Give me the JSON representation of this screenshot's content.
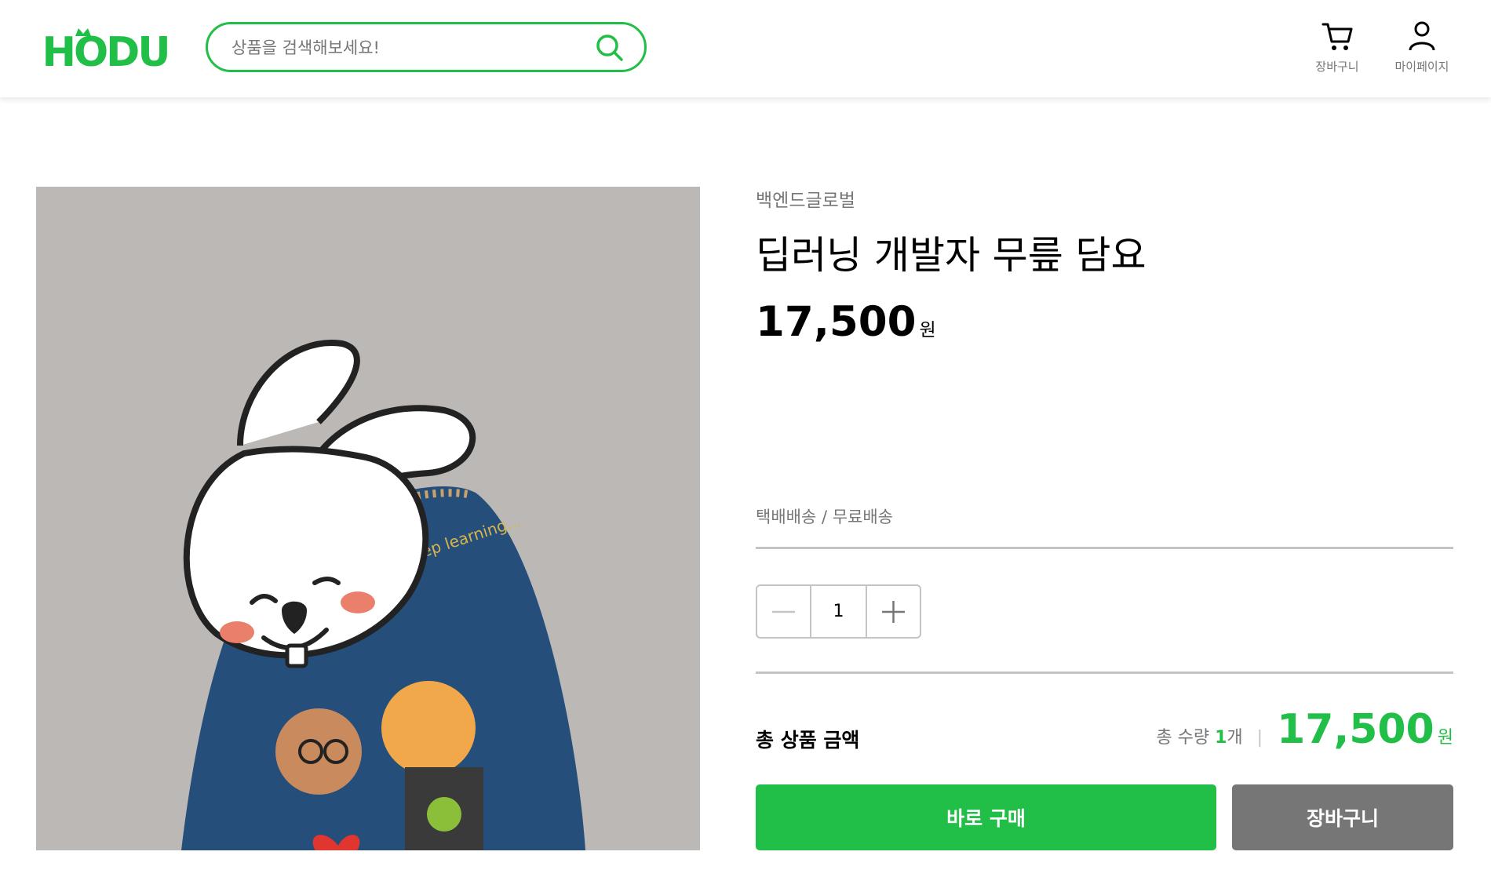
{
  "header": {
    "logo_text": "HODU",
    "search": {
      "placeholder": "상품을 검색해보세요!",
      "value": ""
    },
    "cart_label": "장바구니",
    "mypage_label": "마이페이지"
  },
  "product": {
    "image_text": "deep learning...",
    "seller": "백엔드글로벌",
    "title": "딥러닝 개발자 무릎 담요",
    "price": "17,500",
    "currency": "원",
    "delivery": "택배배송 / 무료배송",
    "quantity": "1"
  },
  "total": {
    "label": "총 상품 금액",
    "count_prefix": "총 수량",
    "count": "1",
    "count_unit": "개",
    "separator": "|",
    "price": "17,500",
    "currency": "원"
  },
  "actions": {
    "buy_label": "바로 구매",
    "cart_label": "장바구니"
  },
  "colors": {
    "accent": "#21bf48",
    "gray": "#767676",
    "border": "#c4c4c4",
    "image_bg": "#bbb8b5"
  },
  "icons": [
    "search-icon",
    "cart-icon",
    "user-icon",
    "minus-icon",
    "plus-icon"
  ]
}
